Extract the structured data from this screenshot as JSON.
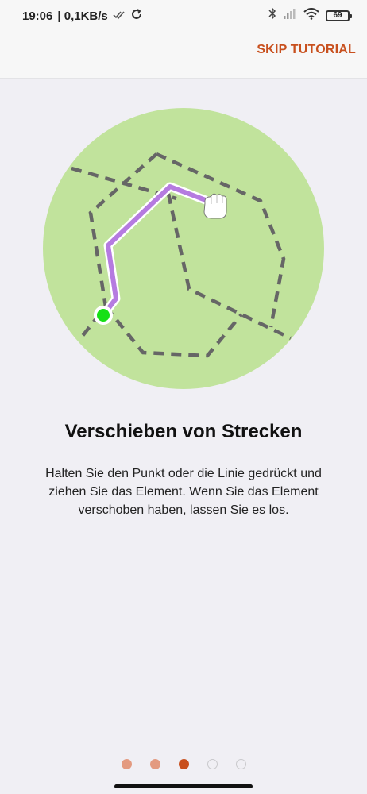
{
  "status_bar": {
    "time": "19:06",
    "network_speed": "| 0,1KB/s",
    "battery_level": "69",
    "icons": [
      "double-check-icon",
      "sync-icon",
      "bluetooth-icon",
      "signal-icon",
      "wifi-icon",
      "battery-icon"
    ]
  },
  "header": {
    "skip_label": "SKIP TUTORIAL"
  },
  "tutorial": {
    "title": "Verschieben von Strecken",
    "description": "Halten Sie den Punkt oder die Linie gedrückt und ziehen Sie das Element. Wenn Sie das Element verschoben haben, lassen Sie es los.",
    "current_page": 3,
    "total_pages": 5
  },
  "colors": {
    "accent": "#c8501e",
    "circle": "#c1e39c",
    "route": "#b57be0",
    "start_point": "#16e016",
    "dashed_lines": "#666666"
  }
}
